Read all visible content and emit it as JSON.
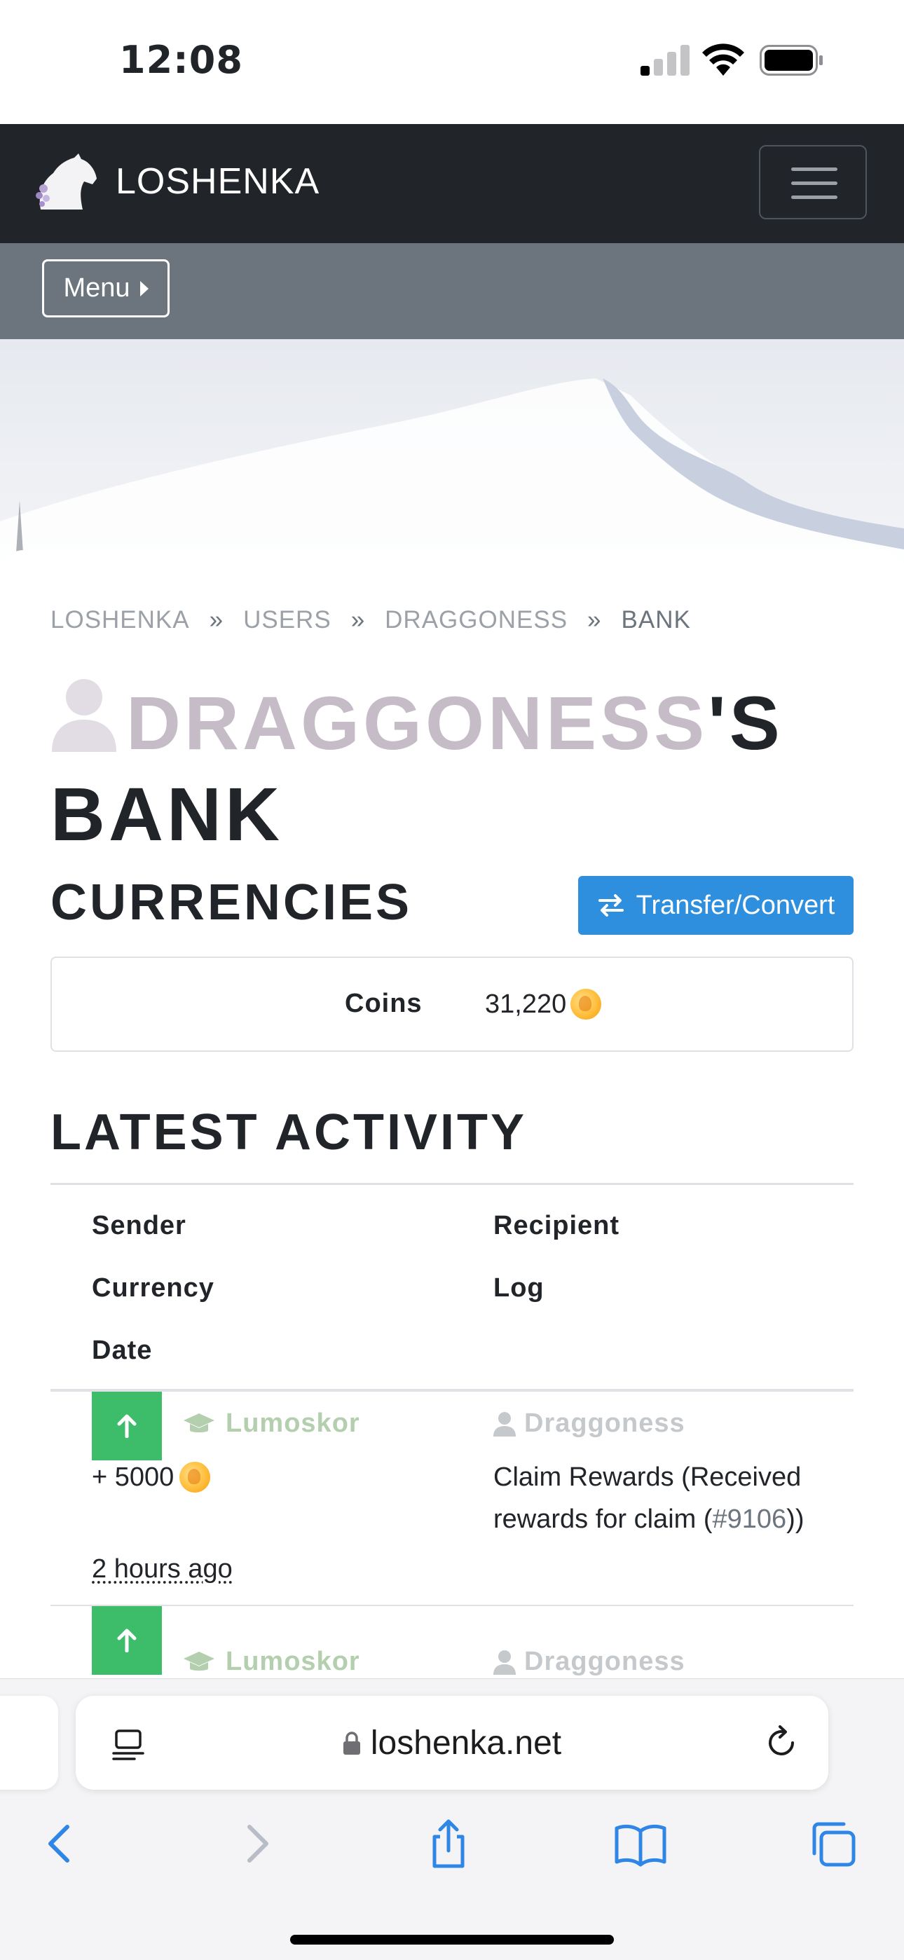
{
  "status_bar": {
    "time": "12:08"
  },
  "navbar": {
    "brand": "LOSHENKA"
  },
  "subbar": {
    "menu_label": "Menu"
  },
  "breadcrumb": [
    "LOSHENKA",
    "USERS",
    "DRAGGONESS",
    "BANK"
  ],
  "breadcrumb_separator": "»",
  "page_title": {
    "username": "DRAGGONESS",
    "suffix": "'S",
    "line2": "BANK"
  },
  "currencies": {
    "heading": "CURRENCIES",
    "transfer_button": "Transfer/Convert",
    "rows": [
      {
        "label": "Coins",
        "value": "31,220"
      }
    ]
  },
  "activity": {
    "heading": "LATEST ACTIVITY",
    "columns": {
      "sender": "Sender",
      "recipient": "Recipient",
      "currency": "Currency",
      "log": "Log",
      "date": "Date"
    },
    "rows": [
      {
        "sender": "Lumoskor",
        "recipient": "Draggoness",
        "amount": "+ 5000",
        "log_prefix": "Claim Rewards (Received rewards for claim (",
        "log_ref": "#9106",
        "log_suffix": "))",
        "date": "2 hours ago"
      },
      {
        "sender": "Lumoskor",
        "recipient": "Draggoness"
      }
    ]
  },
  "browser": {
    "url": "loshenka.net"
  },
  "colors": {
    "navbar": "#212529",
    "subbar": "#6c757d",
    "primary": "#2f8fdf",
    "success": "#3dbd6a",
    "username": "#c6bcc8",
    "sender": "#b3cfae",
    "recipient": "#c6c9cc"
  },
  "icons": [
    "horse-logo-icon",
    "hamburger-icon",
    "caret-right-icon",
    "user-icon",
    "transfer-arrows-icon",
    "coin-icon",
    "arrow-up-icon",
    "graduation-cap-icon",
    "lock-icon",
    "reader-icon",
    "reload-icon",
    "back-icon",
    "forward-icon",
    "share-icon",
    "bookmarks-icon",
    "tabs-icon"
  ]
}
